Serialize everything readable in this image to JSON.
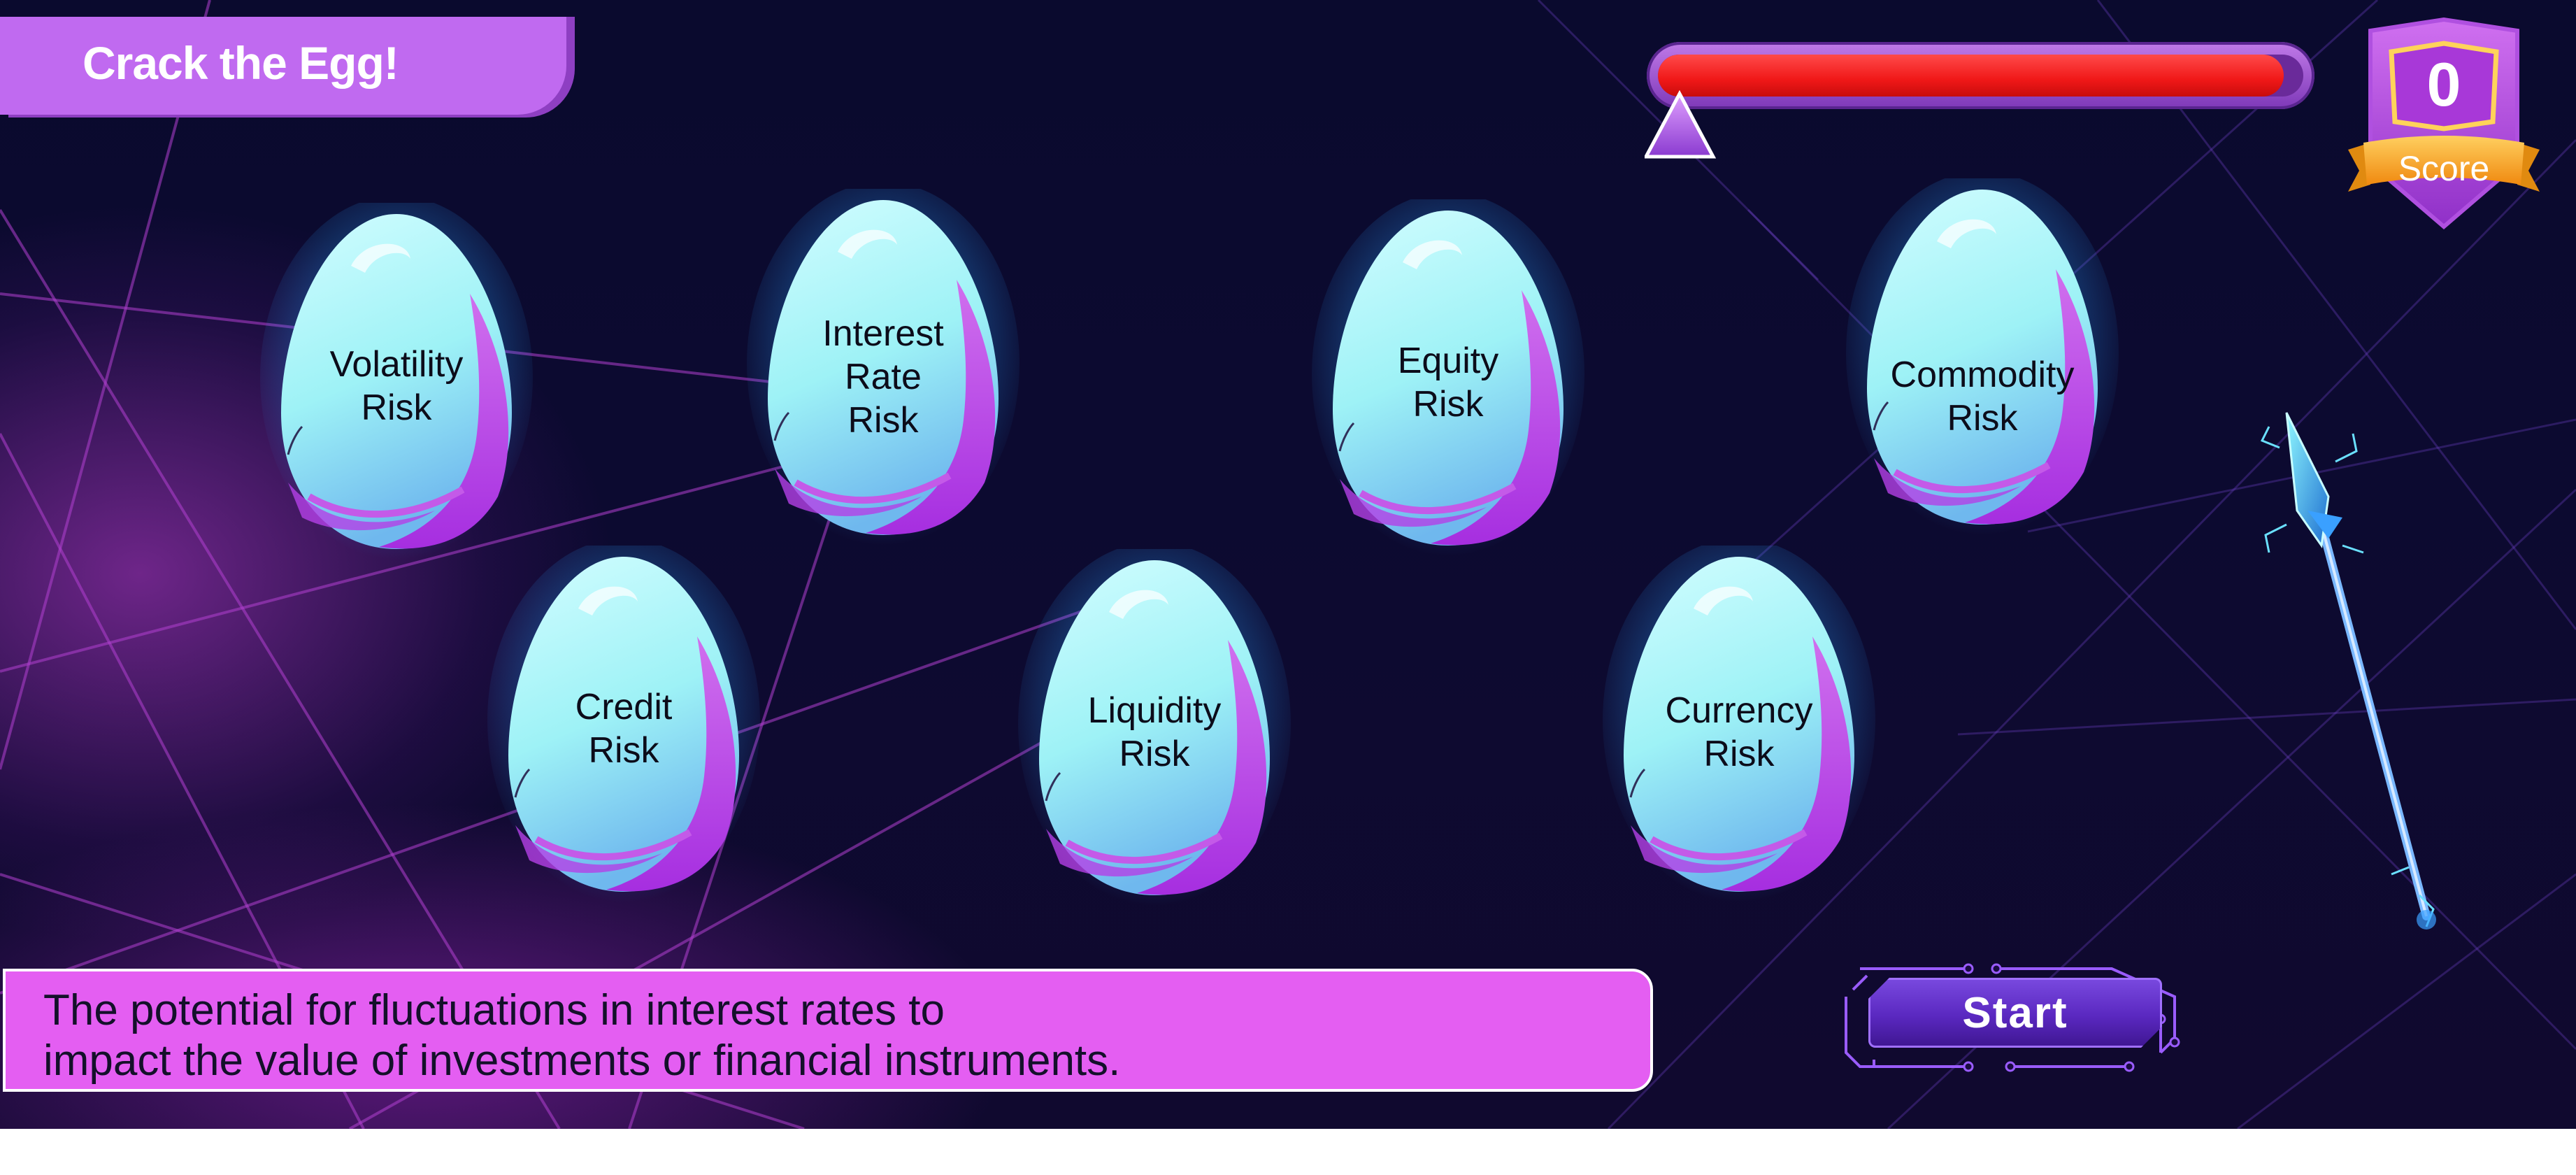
{
  "header": {
    "title": "Crack the Egg!"
  },
  "progress": {
    "fill_fraction": 0.97,
    "marker_icon": "triangle-marker-icon"
  },
  "score": {
    "value": "0",
    "label": "Score",
    "icon": "shield-badge-icon"
  },
  "eggs": [
    {
      "label": "Volatility\nRisk"
    },
    {
      "label": "Interest\nRate\nRisk"
    },
    {
      "label": "Equity\nRisk"
    },
    {
      "label": "Commodity\nRisk"
    },
    {
      "label": "Credit\nRisk"
    },
    {
      "label": "Liquidity\nRisk"
    },
    {
      "label": "Currency\nRisk"
    }
  ],
  "description": {
    "text": "The potential for fluctuations in interest rates to\nimpact the value of investments or financial instruments."
  },
  "start_button": {
    "label": "Start"
  },
  "decor": {
    "wand_icon": "magic-wand-icon"
  },
  "colors": {
    "background": "#0c0a30",
    "title_pill": "#c06af0",
    "progress_fill": "#f01818",
    "description_box": "#e45ef2",
    "start_button": "#5a28c0",
    "egg_top": "#c8fbff",
    "egg_bottom": "#c24ae8"
  }
}
